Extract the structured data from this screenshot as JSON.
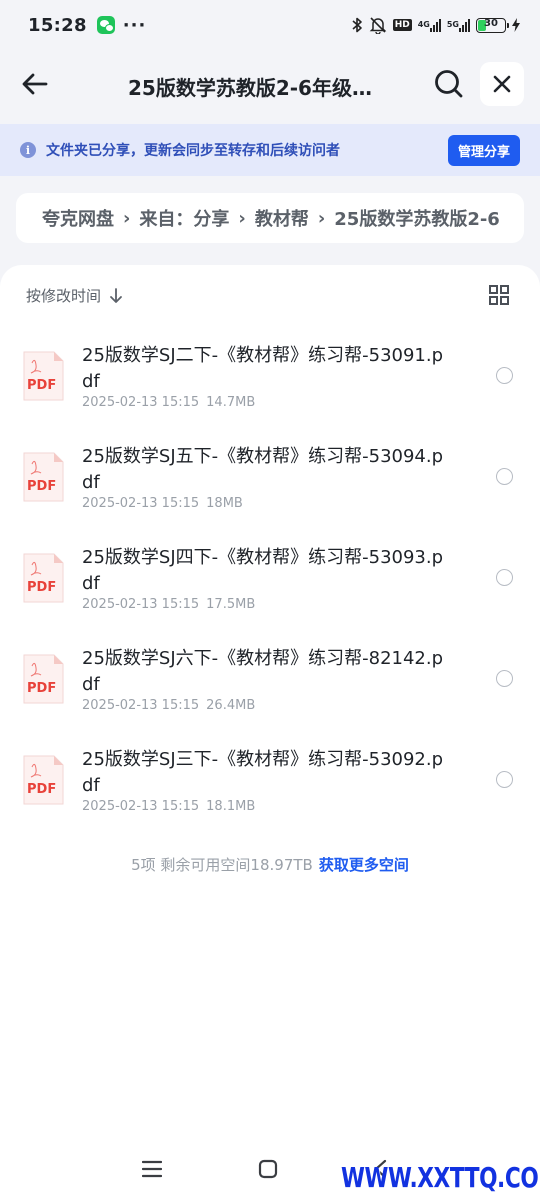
{
  "status_bar": {
    "time": "15:28",
    "dots": "···",
    "hd_badge": "HD",
    "network_1": "4G",
    "network_2": "5G",
    "battery": "30",
    "icons": [
      "wechat-icon",
      "bluetooth-icon",
      "bell-off-icon",
      "signal-icon",
      "battery-icon",
      "charging-icon"
    ]
  },
  "header": {
    "title": "25版数学苏教版2-6年级…",
    "back_icon": "arrow-left-icon",
    "search_icon": "search-icon",
    "close_icon": "close-icon"
  },
  "notice": {
    "text": "文件夹已分享，更新会同步至转存和后续访问者",
    "button": "管理分享"
  },
  "breadcrumb": {
    "items": [
      "夸克网盘",
      "来自：分享",
      "教材帮",
      "25版数学苏教版2-6"
    ]
  },
  "toolbar": {
    "sort_label": "按修改时间",
    "sort_icon": "arrow-down-icon",
    "view_icon": "grid-view-icon"
  },
  "files": [
    {
      "name": "25版数学SJ二下-《教材帮》练习帮-53091.pdf",
      "date": "2025-02-13 15:15",
      "size": "14.7MB",
      "icon_label": "PDF"
    },
    {
      "name": "25版数学SJ五下-《教材帮》练习帮-53094.pdf",
      "date": "2025-02-13 15:15",
      "size": "18MB",
      "icon_label": "PDF"
    },
    {
      "name": "25版数学SJ四下-《教材帮》练习帮-53093.pdf",
      "date": "2025-02-13 15:15",
      "size": "17.5MB",
      "icon_label": "PDF"
    },
    {
      "name": "25版数学SJ六下-《教材帮》练习帮-82142.pdf",
      "date": "2025-02-13 15:15",
      "size": "26.4MB",
      "icon_label": "PDF"
    },
    {
      "name": "25版数学SJ三下-《教材帮》练习帮-53092.pdf",
      "date": "2025-02-13 15:15",
      "size": "18.1MB",
      "icon_label": "PDF"
    }
  ],
  "footer": {
    "summary": "5项 剩余可用空间18.97TB",
    "link": "获取更多空间"
  },
  "watermark": "WWW.XXTTQ.COM",
  "colors": {
    "accent": "#1f5cf0",
    "notice_bg": "#e4e9fb",
    "page_bg": "#f3f4f8",
    "pdf_red": "#e8423a"
  }
}
